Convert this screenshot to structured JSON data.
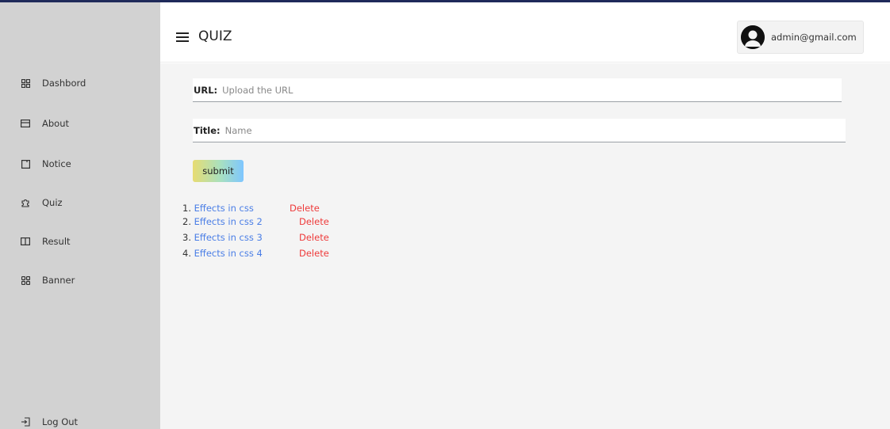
{
  "header": {
    "title": "QUIZ",
    "user_email": "admin@gmail.com"
  },
  "sidebar": {
    "items": [
      {
        "label": "Dashbord",
        "icon": "grid-icon"
      },
      {
        "label": "About",
        "icon": "card-icon"
      },
      {
        "label": "Notice",
        "icon": "square-icon"
      },
      {
        "label": "Quiz",
        "icon": "puzzle-icon"
      },
      {
        "label": "Result",
        "icon": "book-icon"
      },
      {
        "label": "Banner",
        "icon": "apps-icon"
      }
    ],
    "logout": {
      "label": "Log Out",
      "icon": "logout-icon"
    }
  },
  "form": {
    "url_label": "URL:",
    "url_placeholder": "Upload the URL",
    "url_value": "",
    "title_label": "Title:",
    "title_placeholder": "Name",
    "title_value": "",
    "submit_label": "submit"
  },
  "quiz_list": [
    {
      "number": "1.",
      "title": "Effects in css",
      "action": "Delete"
    },
    {
      "number": "2.",
      "title": "Effects in css 2",
      "action": "Delete"
    },
    {
      "number": "3.",
      "title": "Effects in css 3",
      "action": "Delete"
    },
    {
      "number": "4.",
      "title": "Effects in css 4",
      "action": "Delete"
    }
  ],
  "colors": {
    "link": "#4a7ee6",
    "delete": "#ee3a3a",
    "sidebar": "#d2d2d2",
    "main_bg": "#f4f4f4"
  }
}
